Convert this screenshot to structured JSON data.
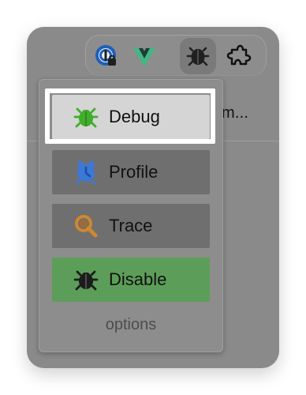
{
  "toolbar": {
    "icons": [
      {
        "name": "1password-lock-icon"
      },
      {
        "name": "vue-devtools-icon"
      },
      {
        "name": "debug-extension-icon"
      },
      {
        "name": "extensions-puzzle-icon"
      }
    ]
  },
  "background": {
    "truncated_text": "m..."
  },
  "popup": {
    "items": [
      {
        "label": "Debug",
        "icon": "green-bug-icon"
      },
      {
        "label": "Profile",
        "icon": "blue-clock-icon"
      },
      {
        "label": "Trace",
        "icon": "orange-magnifier-icon"
      },
      {
        "label": "Disable",
        "icon": "black-bug-icon"
      }
    ],
    "options_label": "options"
  },
  "colors": {
    "window_bg": "#8a8a8a",
    "selected_item_bg": "#d5d5d5",
    "item_bg": "#6f6f6f",
    "disable_bg": "#5c9e59",
    "highlight": "#ffffff",
    "debug_green": "#3fae2a",
    "profile_blue": "#3c78d8",
    "trace_orange": "#d0872d"
  }
}
